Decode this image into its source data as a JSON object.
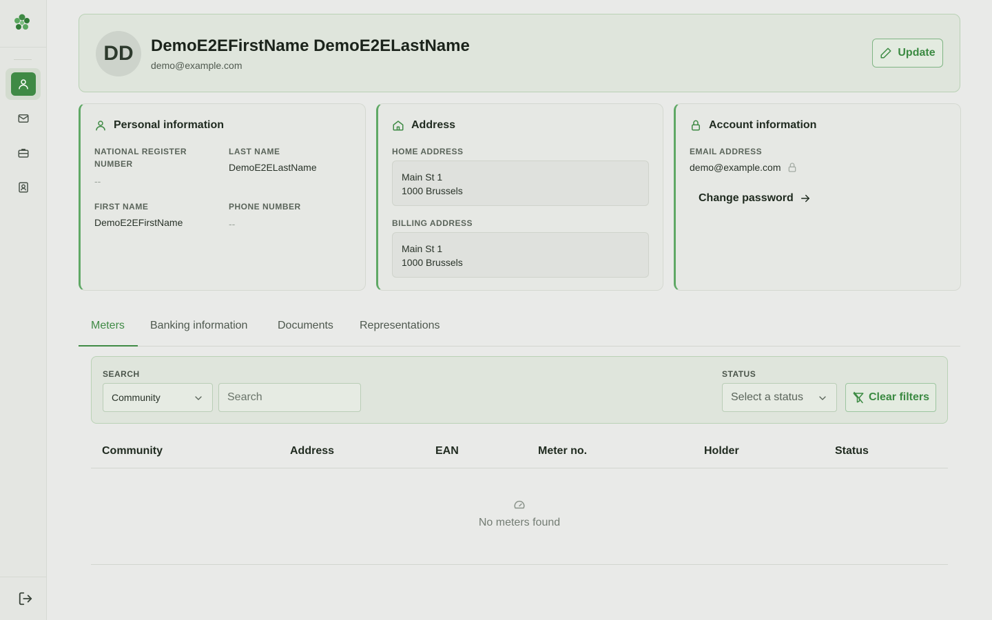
{
  "sidebar": {
    "items": [
      {
        "name": "profile",
        "icon": "user-icon",
        "active": true
      },
      {
        "name": "messages",
        "icon": "mail-icon",
        "active": false
      },
      {
        "name": "jobs",
        "icon": "briefcase-icon",
        "active": false
      },
      {
        "name": "contacts",
        "icon": "contact-card-icon",
        "active": false
      }
    ],
    "logout_icon": "logout-icon"
  },
  "profile": {
    "initials": "DD",
    "name": "DemoE2EFirstName DemoE2ELastName",
    "email": "demo@example.com",
    "update_label": "Update"
  },
  "personal": {
    "title": "Personal information",
    "national_register_label": "NATIONAL REGISTER NUMBER",
    "national_register_value": "--",
    "last_name_label": "LAST NAME",
    "last_name_value": "DemoE2ELastName",
    "first_name_label": "FIRST NAME",
    "first_name_value": "DemoE2EFirstName",
    "phone_label": "PHONE NUMBER",
    "phone_value": "--"
  },
  "address": {
    "title": "Address",
    "home_label": "HOME ADDRESS",
    "home_line1": "Main St 1",
    "home_line2": "1000 Brussels",
    "billing_label": "BILLING ADDRESS",
    "billing_line1": "Main St 1",
    "billing_line2": "1000 Brussels"
  },
  "account": {
    "title": "Account information",
    "email_label": "EMAIL ADDRESS",
    "email_value": "demo@example.com",
    "change_password": "Change password"
  },
  "tabs": [
    {
      "label": "Meters",
      "active": true
    },
    {
      "label": "Banking information",
      "active": false
    },
    {
      "label": "Documents",
      "active": false
    },
    {
      "label": "Representations",
      "active": false
    }
  ],
  "filters": {
    "search_label": "SEARCH",
    "search_field_value": "Community",
    "search_placeholder": "Search",
    "status_label": "STATUS",
    "status_placeholder": "Select a status",
    "clear_label": "Clear filters"
  },
  "table": {
    "columns": [
      "Community",
      "Address",
      "EAN",
      "Meter no.",
      "Holder",
      "Status"
    ],
    "empty_text": "No meters found"
  },
  "colors": {
    "accent": "#3f8a45",
    "background": "#e9eae8"
  }
}
